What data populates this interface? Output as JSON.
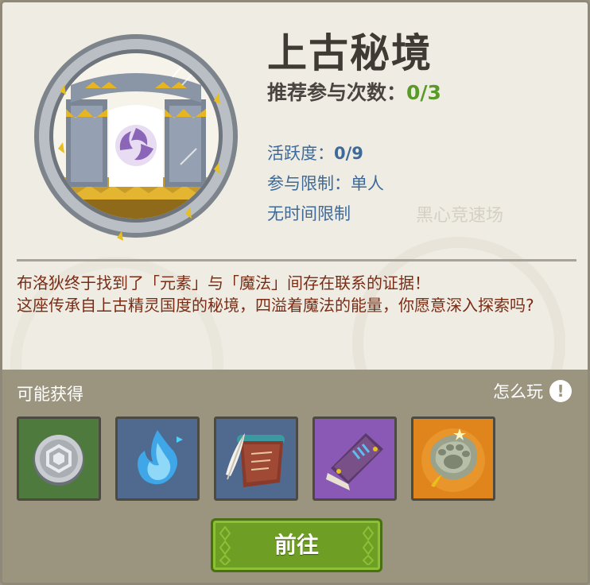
{
  "dungeon": {
    "title": "上古秘境",
    "recommend_label": "推荐参与次数：",
    "recommend_count": "0/3",
    "activity_label": "活跃度：",
    "activity_value": "0/9",
    "participation_limit": "参与限制：单人",
    "time_limit": "无时间限制",
    "watermark": "黑心竞速场",
    "emblem_icon": "ancient-gate-portal-icon"
  },
  "description": {
    "line1": "布洛狄终于找到了「元素」与「魔法」间存在联系的证据！",
    "line2": "这座传承自上古精灵国度的秘境，四溢着魔法的能量，你愿意深入探索吗?"
  },
  "rewards": {
    "label": "可能获得",
    "howto_label": "怎么玩",
    "howto_icon": "!",
    "items": [
      {
        "icon": "silver-coin-icon",
        "bg": "#4f7a3e"
      },
      {
        "icon": "blue-flame-crystal-icon",
        "bg": "#4f6a8e"
      },
      {
        "icon": "scroll-quill-icon",
        "bg": "#4f6a8e"
      },
      {
        "icon": "magic-tome-icon",
        "bg": "#8a58b5"
      },
      {
        "icon": "stone-paw-amulet-icon",
        "bg": "#e0841c"
      }
    ]
  },
  "actions": {
    "go_label": "前往"
  },
  "colors": {
    "panel_bg": "#efece3",
    "lower_bg": "#9b957f",
    "count_green": "#5a9a2a",
    "info_blue": "#3e6a9a",
    "desc_brown": "#7a2c14",
    "button_green": "#6f9e24"
  }
}
